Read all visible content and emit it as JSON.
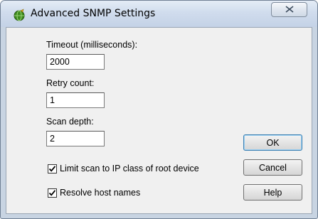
{
  "window": {
    "title": "Advanced SNMP Settings",
    "app_icon": "snmp-globe-icon",
    "close_icon": "close-icon"
  },
  "fields": {
    "timeout": {
      "label": "Timeout (milliseconds):",
      "value": "2000"
    },
    "retry": {
      "label": "Retry count:",
      "value": "1"
    },
    "depth": {
      "label": "Scan depth:",
      "value": "2"
    }
  },
  "checkboxes": {
    "limit_scan": {
      "label": "Limit scan to IP class of root device",
      "checked": true
    },
    "resolve_names": {
      "label": "Resolve host names",
      "checked": true
    }
  },
  "buttons": {
    "ok": "OK",
    "cancel": "Cancel",
    "help": "Help"
  },
  "colors": {
    "titlebar": "#d0dced",
    "client": "#f0f0f0",
    "icon_green": "#3e8c1f"
  }
}
